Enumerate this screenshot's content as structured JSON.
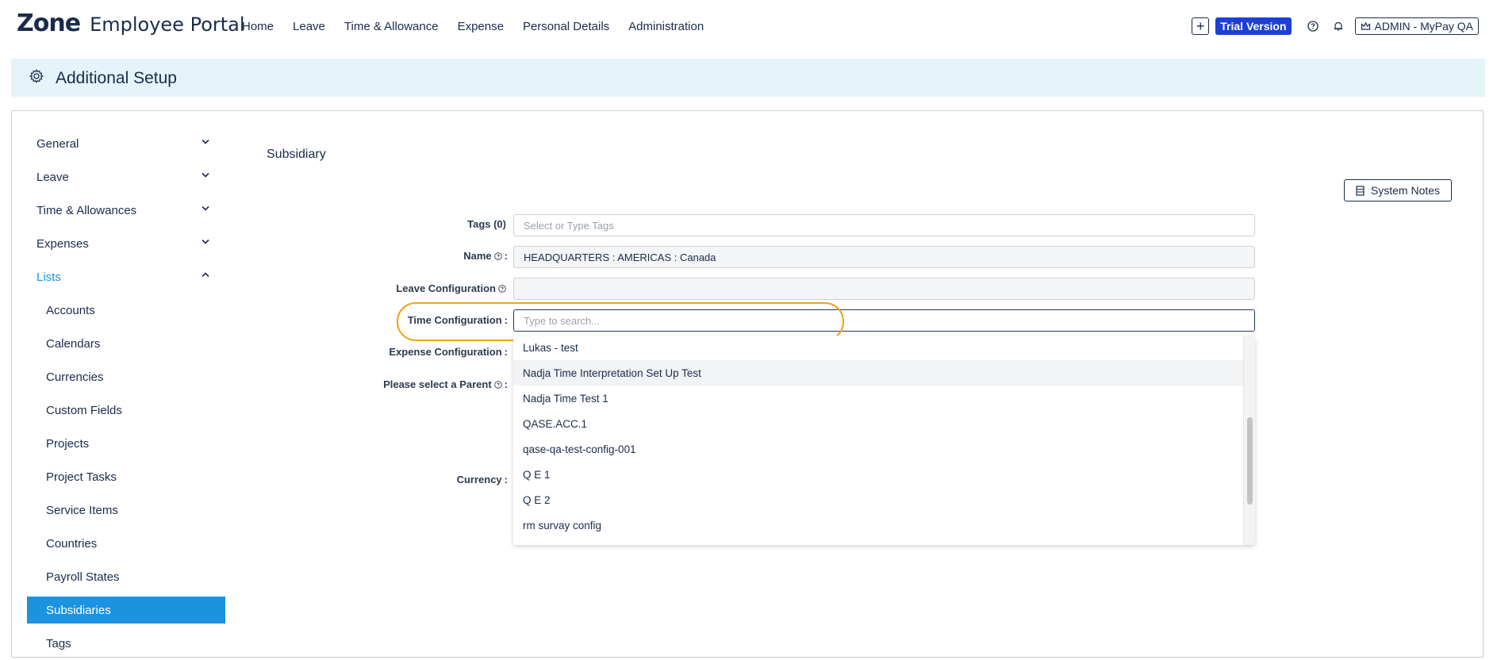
{
  "brand": {
    "logo": "Zone",
    "portal": "Employee Portal"
  },
  "nav": [
    "Home",
    "Leave",
    "Time & Allowance",
    "Expense",
    "Personal Details",
    "Administration"
  ],
  "top_right": {
    "trial": "Trial Version",
    "user": "ADMIN  -  MyPay QA"
  },
  "header": {
    "title": "Additional Setup"
  },
  "sidebar": {
    "sections": [
      {
        "label": "General",
        "open": false
      },
      {
        "label": "Leave",
        "open": false
      },
      {
        "label": "Time & Allowances",
        "open": false
      },
      {
        "label": "Expenses",
        "open": false
      },
      {
        "label": "Lists",
        "open": true
      }
    ],
    "list_items": [
      "Accounts",
      "Calendars",
      "Currencies",
      "Custom Fields",
      "Projects",
      "Project Tasks",
      "Service Items",
      "Countries",
      "Payroll States",
      "Subsidiaries",
      "Tags"
    ],
    "active": "Subsidiaries"
  },
  "form": {
    "section_title": "Subsidiary",
    "system_notes": "System Notes",
    "tags_label": "Tags (0)",
    "tags_placeholder": "Select or Type Tags",
    "name_label": "Name",
    "name_value": "HEADQUARTERS : AMERICAS : Canada",
    "leave_config_label": "Leave Configuration",
    "leave_config_value": "",
    "time_config_label": "Time Configuration",
    "time_config_placeholder": "Type to search...",
    "expense_config_label": "Expense Configuration",
    "parent_label": "Please select a Parent",
    "currency_label": "Currency",
    "colon": ":"
  },
  "dropdown": {
    "options": [
      "Lukas - test",
      "Nadja Time Interpretation Set Up Test",
      "Nadja Time Test 1",
      "QASE.ACC.1",
      "qase-qa-test-config-001",
      "Q E 1",
      "Q E 2",
      "rm survay config"
    ],
    "hovered": "Nadja Time Interpretation Set Up Test"
  },
  "colors": {
    "accent": "#1b93e0",
    "trial_badge": "#1d3fd6",
    "highlight": "#f0a21c",
    "header_bg": "#e4f4f9"
  }
}
